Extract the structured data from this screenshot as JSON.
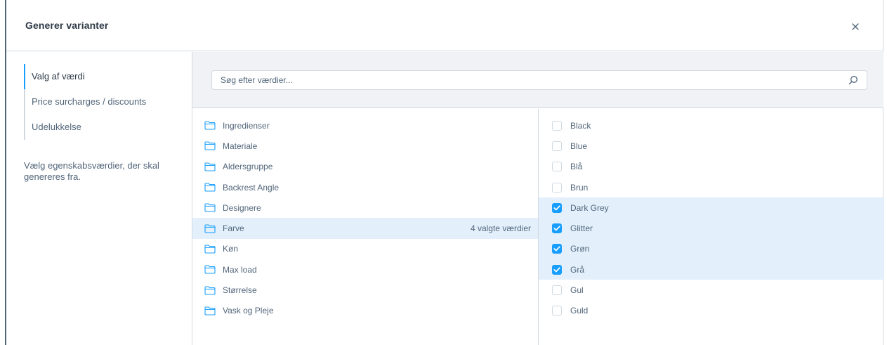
{
  "modal": {
    "title": "Generer varianter"
  },
  "sidebar": {
    "tabs": [
      {
        "label": "Valg af værdi",
        "active": true
      },
      {
        "label": "Price surcharges / discounts",
        "active": false
      },
      {
        "label": "Udelukkelse",
        "active": false
      }
    ],
    "help_text": "Vælg egenskabsværdier, der skal genereres fra."
  },
  "search": {
    "placeholder": "Søg efter værdier..."
  },
  "groups": [
    {
      "label": "Ingredienser",
      "selected": false,
      "count": ""
    },
    {
      "label": "Materiale",
      "selected": false,
      "count": ""
    },
    {
      "label": "Aldersgruppe",
      "selected": false,
      "count": ""
    },
    {
      "label": "Backrest Angle",
      "selected": false,
      "count": ""
    },
    {
      "label": "Designere",
      "selected": false,
      "count": ""
    },
    {
      "label": "Farve",
      "selected": true,
      "count": "4 valgte værdier"
    },
    {
      "label": "Køn",
      "selected": false,
      "count": ""
    },
    {
      "label": "Max load",
      "selected": false,
      "count": ""
    },
    {
      "label": "Størrelse",
      "selected": false,
      "count": ""
    },
    {
      "label": "Vask og Pleje",
      "selected": false,
      "count": ""
    }
  ],
  "values": [
    {
      "label": "Black",
      "checked": false
    },
    {
      "label": "Blue",
      "checked": false
    },
    {
      "label": "Blå",
      "checked": false
    },
    {
      "label": "Brun",
      "checked": false
    },
    {
      "label": "Dark Grey",
      "checked": true
    },
    {
      "label": "Glitter",
      "checked": true
    },
    {
      "label": "Grøn",
      "checked": true
    },
    {
      "label": "Grå",
      "checked": true
    },
    {
      "label": "Gul",
      "checked": false
    },
    {
      "label": "Guld",
      "checked": false
    }
  ],
  "colors": {
    "accent": "#189eff",
    "selected_bg": "#e3f0fc",
    "border": "#d1d9e0",
    "text": "#52667a"
  },
  "icons": {
    "close": "close-icon",
    "search": "search-icon",
    "folder": "folder-icon",
    "check": "check-icon"
  }
}
